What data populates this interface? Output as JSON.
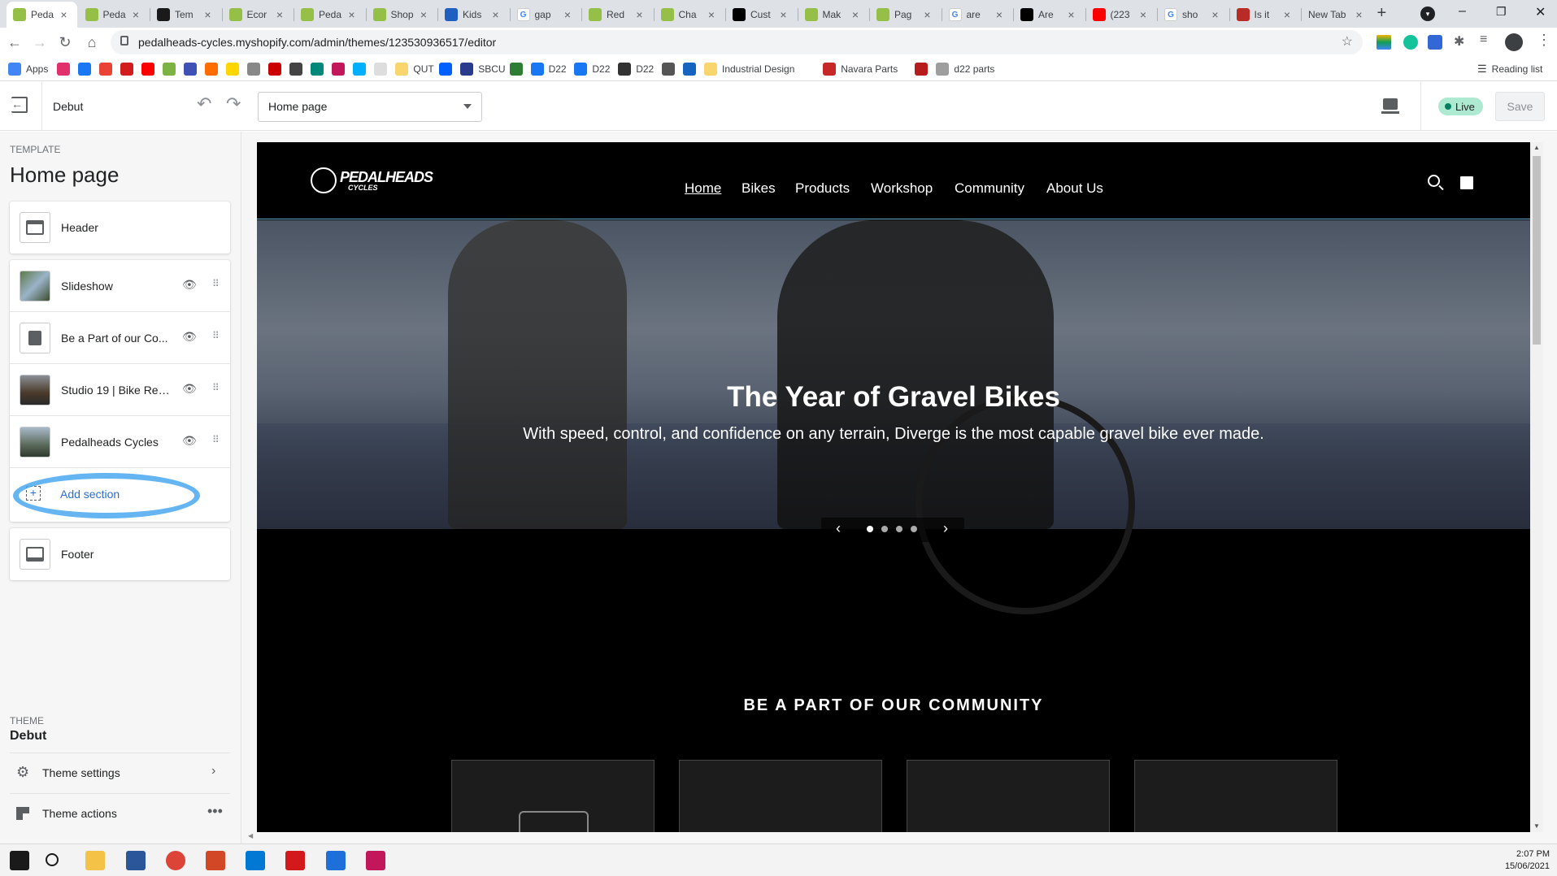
{
  "browser": {
    "tabs": [
      {
        "title": "Peda",
        "icon": "shopify-icon",
        "color": "#95bf47",
        "active": true
      },
      {
        "title": "Peda",
        "icon": "shopify-icon",
        "color": "#95bf47"
      },
      {
        "title": "Tem",
        "icon": "dark-square-icon",
        "color": "#1a1a1a"
      },
      {
        "title": "Ecor",
        "icon": "shopify-icon",
        "color": "#95bf47"
      },
      {
        "title": "Peda",
        "icon": "shopify-icon",
        "color": "#95bf47"
      },
      {
        "title": "Shop",
        "icon": "shopify-icon",
        "color": "#95bf47"
      },
      {
        "title": "Kids",
        "icon": "blue-square-icon",
        "color": "#1f5fbf"
      },
      {
        "title": "gap",
        "icon": "google-icon",
        "color": "#4285f4"
      },
      {
        "title": "Red",
        "icon": "shopify-icon",
        "color": "#95bf47"
      },
      {
        "title": "Cha",
        "icon": "shopify-icon",
        "color": "#95bf47"
      },
      {
        "title": "Cust",
        "icon": "black-square-icon",
        "color": "#000000"
      },
      {
        "title": "Mak",
        "icon": "shopify-icon",
        "color": "#95bf47"
      },
      {
        "title": "Pag",
        "icon": "shopify-icon",
        "color": "#95bf47"
      },
      {
        "title": "are",
        "icon": "google-icon",
        "color": "#4285f4"
      },
      {
        "title": "Are",
        "icon": "black-square-icon",
        "color": "#000000"
      },
      {
        "title": "(223",
        "icon": "youtube-icon",
        "color": "#ff0000"
      },
      {
        "title": "sho",
        "icon": "google-icon",
        "color": "#4285f4"
      },
      {
        "title": "Is it",
        "icon": "quora-icon",
        "color": "#b92b27"
      },
      {
        "title": "New Tab",
        "icon": "",
        "color": ""
      }
    ],
    "url": "pedalheads-cycles.myshopify.com/admin/themes/123530936517/editor",
    "bookmarks": [
      {
        "label": "Apps",
        "color": "#4285f4"
      },
      {
        "label": "",
        "color": "#e1306c"
      },
      {
        "label": "",
        "color": "#1877f2"
      },
      {
        "label": "",
        "color": "#ea4335"
      },
      {
        "label": "",
        "color": "#d11d1d"
      },
      {
        "label": "",
        "color": "#ff0000"
      },
      {
        "label": "",
        "color": "#7cb342"
      },
      {
        "label": "",
        "color": "#3f51b5"
      },
      {
        "label": "",
        "color": "#ff6d00"
      },
      {
        "label": "",
        "color": "#ffd600"
      },
      {
        "label": "",
        "color": "#888888"
      },
      {
        "label": "",
        "color": "#cc0000"
      },
      {
        "label": "",
        "color": "#444444"
      },
      {
        "label": "",
        "color": "#00897b"
      },
      {
        "label": "",
        "color": "#c2185b"
      },
      {
        "label": "",
        "color": "#00b0ff"
      },
      {
        "label": "",
        "color": "#dddddd"
      },
      {
        "label": "QUT",
        "color": "#f9d56e"
      },
      {
        "label": "",
        "color": "#0061ff"
      },
      {
        "label": "SBCU",
        "color": "#2a3a8c"
      },
      {
        "label": "",
        "color": "#2e7d32"
      },
      {
        "label": "D22",
        "color": "#1877f2"
      },
      {
        "label": "D22",
        "color": "#1877f2"
      },
      {
        "label": "D22",
        "color": "#333333"
      },
      {
        "label": "",
        "color": "#555555"
      },
      {
        "label": "",
        "color": "#1565c0"
      },
      {
        "label": "Industrial Design",
        "color": "#f9d56e"
      },
      {
        "label": "Navara Parts",
        "color": "#c62828"
      },
      {
        "label": "",
        "color": "#b71c1c"
      },
      {
        "label": "d22 parts",
        "color": "#9e9e9e"
      }
    ],
    "reading_list": "Reading list"
  },
  "topbar": {
    "theme_name": "Debut",
    "page_select": "Home page",
    "live_badge": "Live",
    "save_label": "Save"
  },
  "sidebar": {
    "template_label": "TEMPLATE",
    "template_title": "Home page",
    "header_item": "Header",
    "sections": [
      {
        "label": "Slideshow"
      },
      {
        "label": "Be a Part of our Co..."
      },
      {
        "label": "Studio 19 | Bike Ren..."
      },
      {
        "label": "Pedalheads Cycles"
      }
    ],
    "add_section": "Add section",
    "footer_item": "Footer",
    "theme_label": "THEME",
    "theme_name": "Debut",
    "theme_settings": "Theme settings",
    "theme_actions": "Theme actions"
  },
  "store": {
    "logo_text": "PEDALHEADS",
    "logo_sub": "CYCLES",
    "nav": [
      "Home",
      "Bikes",
      "Products",
      "Workshop",
      "Community",
      "About Us"
    ],
    "hero_title": "The Year of Gravel Bikes",
    "hero_subtitle": "With speed, control, and confidence on any terrain, Diverge is the most capable gravel bike ever made.",
    "slide_count": 4,
    "active_slide": 1,
    "community_heading": "BE A PART OF OUR COMMUNITY"
  },
  "taskbar": {
    "time": "2:07 PM",
    "date": "15/06/2021",
    "apps": [
      {
        "name": "windows-start-icon",
        "color": "#1a1a1a"
      },
      {
        "name": "search-icon",
        "color": "#1a1a1a"
      },
      {
        "name": "file-explorer-icon",
        "color": "#f3c246"
      },
      {
        "name": "word-icon",
        "color": "#2b579a"
      },
      {
        "name": "chrome-icon",
        "color": "#db4437"
      },
      {
        "name": "powerpoint-icon",
        "color": "#d24726"
      },
      {
        "name": "outlook-icon",
        "color": "#0078d4"
      },
      {
        "name": "acrobat-icon",
        "color": "#d4191c"
      },
      {
        "name": "photos-icon",
        "color": "#1e6fd9"
      },
      {
        "name": "snipping-tool-icon",
        "color": "#c2185b"
      }
    ]
  }
}
